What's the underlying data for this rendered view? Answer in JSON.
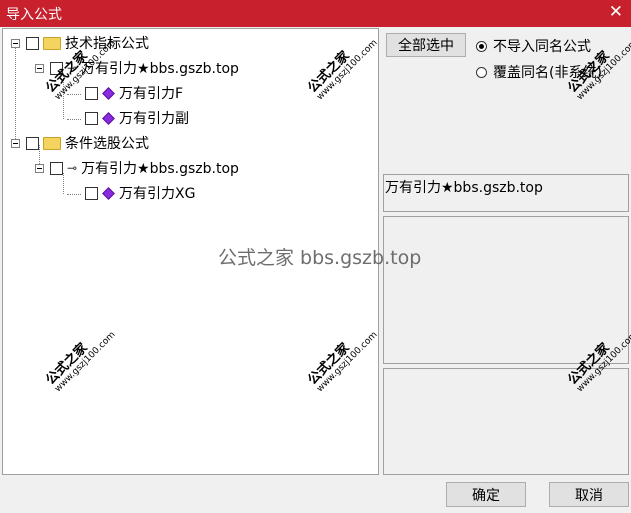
{
  "window": {
    "title": "导入公式",
    "close_glyph": "✕"
  },
  "tree": {
    "groups": [
      {
        "label": "技术指标公式",
        "children": [
          {
            "label": "万有引力★bbs.gszb.top",
            "icon": "key-icon",
            "children": [
              {
                "label": "万有引力F",
                "icon": "formula-gem-icon"
              },
              {
                "label": "万有引力副",
                "icon": "formula-gem-icon"
              }
            ]
          }
        ]
      },
      {
        "label": "条件选股公式",
        "children": [
          {
            "label": "万有引力★bbs.gszb.top",
            "icon": "key-icon",
            "children": [
              {
                "label": "万有引力XG",
                "icon": "formula-gem-icon"
              }
            ]
          }
        ]
      }
    ]
  },
  "controls": {
    "select_all": "全部选中",
    "radio_skip": "不导入同名公式",
    "radio_overwrite": "覆盖同名(非系统)",
    "selected_name": "万有引力★bbs.gszb.top",
    "ok": "确定",
    "cancel": "取消"
  },
  "watermark": {
    "brand": "公式之家",
    "site": "www.gszj100.com",
    "center": "公式之家 bbs.gszb.top"
  }
}
